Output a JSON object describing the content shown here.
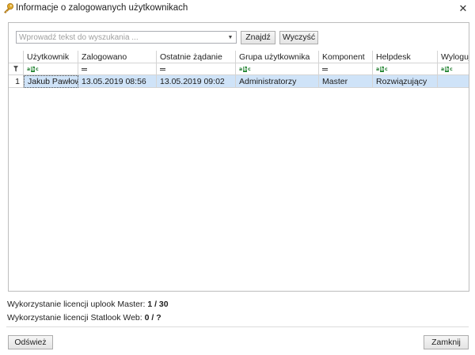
{
  "window": {
    "title": "Informacje o zalogowanych użytkownikach",
    "close_glyph": "✕"
  },
  "search": {
    "placeholder": "Wprowadź tekst do wyszukania ...",
    "value": "",
    "find_label": "Znajdź",
    "clear_label": "Wyczyść"
  },
  "grid": {
    "columns": [
      "Użytkownik",
      "Zalogowano",
      "Ostatnie żądanie",
      "Grupa użytkownika",
      "Komponent",
      "Helpdesk",
      "Wyloguj"
    ],
    "filter_types": [
      "text",
      "equals",
      "equals",
      "text",
      "equals",
      "text",
      "text"
    ],
    "rows": [
      {
        "index": "1",
        "cells": [
          "Jakub Pawłowski",
          "13.05.2019 08:56",
          "13.05.2019 09:02",
          "Administratorzy",
          "Master",
          "Rozwiązujący",
          ""
        ]
      }
    ]
  },
  "licenses": {
    "master_label": "Wykorzystanie licencji uplook Master:",
    "master_value": "1 / 30",
    "web_label": "Wykorzystanie licencji Statlook Web:",
    "web_value": "0 / ?"
  },
  "footer": {
    "refresh_label": "Odśwież",
    "close_label": "Zamknij"
  },
  "colors": {
    "selection": "#cfe3f8",
    "border": "#bdbdbd",
    "key_icon": "#d4a017"
  },
  "icons": {
    "title": "key-icon",
    "close": "close-icon",
    "filter_row": "filter-icon",
    "text_filter": "abc-filter-icon",
    "equals_filter": "equals-filter-icon"
  }
}
